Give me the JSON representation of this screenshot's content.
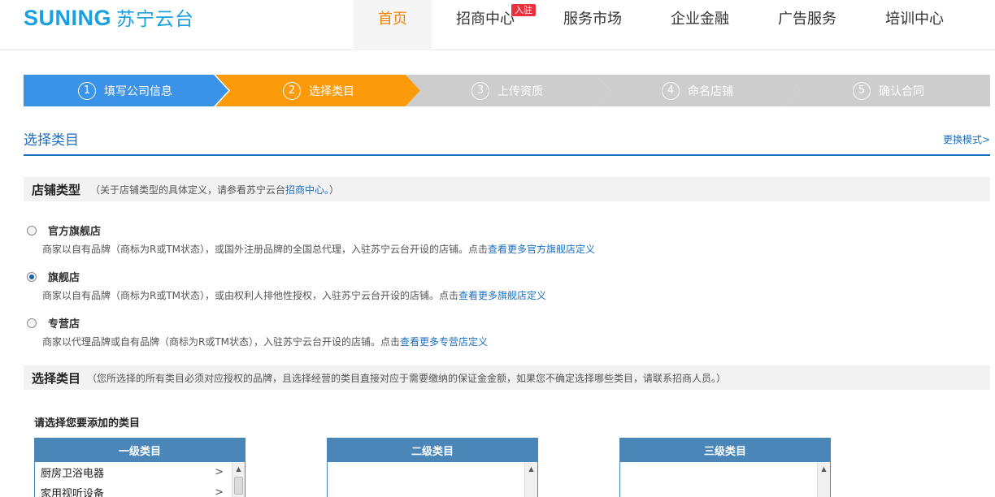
{
  "header": {
    "logo_en": "SUNING",
    "logo_cn": "苏宁云台",
    "nav": [
      {
        "label": "首页",
        "active": true
      },
      {
        "label": "招商中心",
        "badge": "入驻"
      },
      {
        "label": "服务市场"
      },
      {
        "label": "企业金融"
      },
      {
        "label": "广告服务"
      },
      {
        "label": "培训中心"
      }
    ]
  },
  "steps": [
    {
      "num": "1",
      "label": "填写公司信息",
      "state": "done",
      "color": "#3a93e6"
    },
    {
      "num": "2",
      "label": "选择类目",
      "state": "current",
      "color": "#fb9a0b"
    },
    {
      "num": "3",
      "label": "上传资质",
      "state": "todo",
      "color": "#cdcdcd"
    },
    {
      "num": "4",
      "label": "命名店铺",
      "state": "todo",
      "color": "#cdcdcd"
    },
    {
      "num": "5",
      "label": "确认合同",
      "state": "todo",
      "color": "#cdcdcd"
    }
  ],
  "section": {
    "title": "选择类目",
    "switch_link": "更换模式>"
  },
  "store_type": {
    "title": "店铺类型",
    "note_prefix": "（关于店铺类型的具体定义，请参看苏宁云台",
    "note_link": "招商中心。",
    "note_suffix": "）",
    "options": [
      {
        "label": "官方旗舰店",
        "checked": false,
        "desc": "商家以自有品牌（商标为R或TM状态），或国外注册品牌的全国总代理，入驻苏宁云台开设的店铺。点击",
        "link": "查看更多官方旗舰店定义"
      },
      {
        "label": "旗舰店",
        "checked": true,
        "desc": "商家以自有品牌（商标为R或TM状态），或由权利人排他性授权，入驻苏宁云台开设的店铺。点击",
        "link": "查看更多旗舰店定义"
      },
      {
        "label": "专营店",
        "checked": false,
        "desc": "商家以代理品牌或自有品牌（商标为R或TM状态），入驻苏宁云台开设的店铺。点击",
        "link": "查看更多专营店定义"
      }
    ]
  },
  "category": {
    "title": "选择类目",
    "note": "（您所选择的所有类目必须对应授权的品牌，且选择经营的类目直接对应于需要缴纳的保证金金额，如果您不确定选择哪些类目，请联系招商人员。）",
    "pick_title": "请选择您要添加的类目",
    "level1": {
      "header": "一级类目",
      "items": [
        "厨房卫浴电器",
        "家用视听设备"
      ]
    },
    "level2": {
      "header": "二级类目"
    },
    "level3": {
      "header": "三级类目"
    }
  }
}
